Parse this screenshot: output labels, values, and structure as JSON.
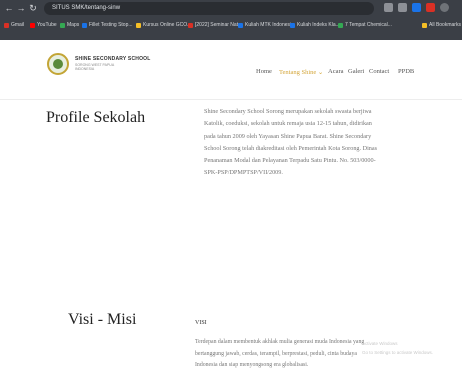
{
  "browser": {
    "url": "SITUS SMK/tentang-sinw",
    "bookmarks": [
      {
        "label": "Gmail",
        "color": "#d93025"
      },
      {
        "label": "YouTube",
        "color": "#ff0000"
      },
      {
        "label": "Maps",
        "color": "#34a853"
      },
      {
        "label": "Fillet Testing Stop...",
        "color": "#1a73e8"
      },
      {
        "label": "Kursus Online GCO...",
        "color": "#f6bf26"
      },
      {
        "label": "[2022] Seminar Nat...",
        "color": "#d93025"
      },
      {
        "label": "Kuliah MTK Indonesi...",
        "color": "#1a73e8"
      },
      {
        "label": "Kuliah Indeks Kla...",
        "color": "#1a73e8"
      },
      {
        "label": "7 Tempat Chemical...",
        "color": "#34a853"
      },
      {
        "label": "All Bookmarks",
        "color": "#f6bf26"
      }
    ]
  },
  "site": {
    "brand": "SHINE SECONDARY SCHOOL",
    "brand_sub": "SORONG WEST PAPUA INDONESIA",
    "menu": {
      "home": "Home",
      "tentang": "Tentang Shine",
      "acara": "Acara",
      "galeri": "Galeri",
      "contact": "Contact",
      "ppdb": "PPDB"
    }
  },
  "profile": {
    "title": "Profile Sekolah",
    "lines": [
      "Shine Secondary School Sorong merupakan sekolah swasta berjiwa",
      "Katolik, coeduksi, sekolah untuk remaja usia 12-15 tahun, didirikan",
      "pada tahun 2009 oleh Yayasan Shine Papua Barat. Shine Secondary",
      "School Sorong telah diakreditasi oleh Pemerintah Kota Sorong. Dinas",
      "Penanaman Modal dan Pelayanan Terpadu Satu Pintu. No. 503/0000-",
      "SPK-PSP/DPMPTSP/VII/2009."
    ]
  },
  "visi_misi": {
    "title": "Visi - Misi",
    "visi_label": "VISI",
    "visi_lines": [
      "Terdepan dalam membentuk akhlak mulia generasi muda Indonesia yang",
      "bertanggung jawab, cerdas, terampil, berprestasi, peduli, cinta budaya",
      "Indonesia dan siap menyongsong era globalisasi."
    ]
  },
  "watermark": {
    "line1": "Activate Windows",
    "line2": "Go to Settings to activate Windows."
  }
}
